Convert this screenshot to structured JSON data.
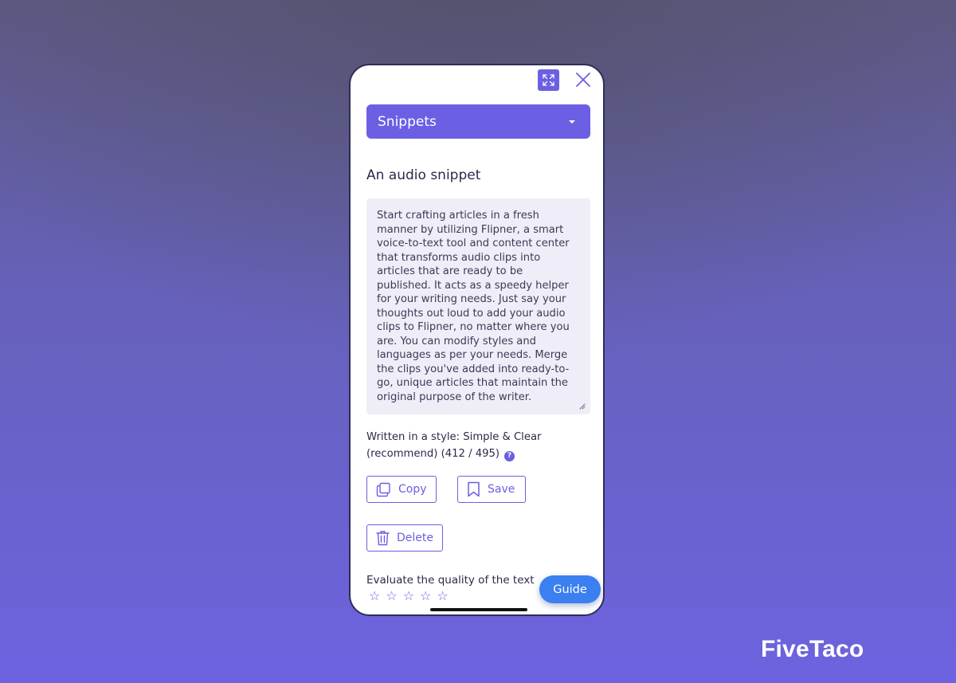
{
  "colors": {
    "accent": "#6b5fe3",
    "guide_button": "#3b7ff0",
    "text_area_bg": "#efeef8",
    "text_dark": "#2c2a4a"
  },
  "header": {
    "expand_icon": "expand-arrows-icon",
    "close_icon": "close-x-icon"
  },
  "dropdown": {
    "selected": "Snippets",
    "icon": "caret-down-icon"
  },
  "snippet": {
    "title": "An audio snippet",
    "body": "Start crafting articles in a fresh manner by utilizing Flipner, a smart voice-to-text tool and content center that transforms audio clips into articles that are ready to be published. It acts as a speedy helper for your writing needs. Just say your thoughts out loud to add your audio clips to Flipner, no matter where you are. You can modify styles and languages as per your needs. Merge the clips you've added into ready-to-go, unique articles that maintain the original purpose of the writer.",
    "style_note": "Written in a style: Simple & Clear (recommend) (412 / 495)",
    "help_glyph": "?"
  },
  "actions": {
    "copy_label": "Copy",
    "save_label": "Save",
    "delete_label": "Delete"
  },
  "rating": {
    "prompt": "Evaluate the quality of the text",
    "max_stars": 5,
    "selected_stars": 0
  },
  "guide": {
    "label": "Guide"
  },
  "brand": {
    "name": "FiveTaco"
  }
}
